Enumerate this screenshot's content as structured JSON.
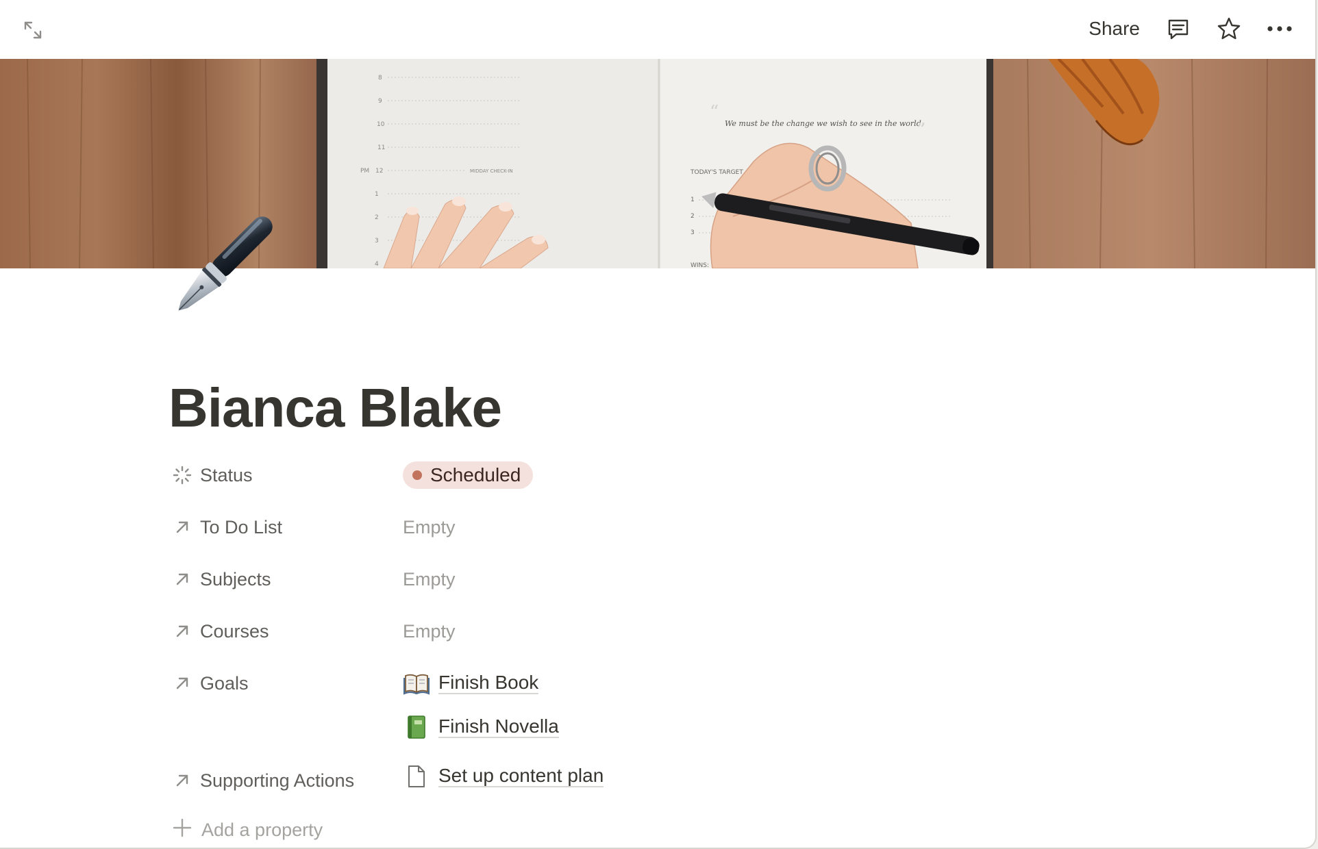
{
  "topbar": {
    "expand_icon": "expand-arrows-icon",
    "share_label": "Share",
    "comment_icon": "comment-icon",
    "favorite_icon": "star-icon",
    "more_icon": "more-dots-icon"
  },
  "cover": {
    "quote": "We must be the change we wish to see in the world.",
    "today_label": "TODAY'S TARGET",
    "wins_label": "WINS:",
    "pm_label": "PM",
    "midday_label": "MIDDAY CHECK-IN",
    "hours": [
      "8",
      "9",
      "10",
      "11",
      "12",
      "1",
      "2",
      "3",
      "4"
    ],
    "targets": [
      "1",
      "2",
      "3"
    ]
  },
  "page": {
    "icon": "fountain-pen-icon",
    "title": "Bianca Blake"
  },
  "properties": {
    "status": {
      "label": "Status",
      "icon": "status-spinner-icon",
      "value": "Scheduled",
      "color": "#c2735e",
      "bg": "#f4e0dc"
    },
    "todo": {
      "label": "To Do List",
      "icon": "relation-arrow-icon",
      "value": "Empty"
    },
    "subjects": {
      "label": "Subjects",
      "icon": "relation-arrow-icon",
      "value": "Empty"
    },
    "courses": {
      "label": "Courses",
      "icon": "relation-arrow-icon",
      "value": "Empty"
    },
    "goals": {
      "label": "Goals",
      "icon": "relation-arrow-icon",
      "items": [
        {
          "label": "Finish Book",
          "icon": "open-book-icon"
        },
        {
          "label": "Finish Novella",
          "icon": "green-book-icon"
        }
      ]
    },
    "supporting": {
      "label": "Supporting Actions",
      "icon": "relation-arrow-icon",
      "items": [
        {
          "label": "Set up content plan",
          "icon": "page-icon"
        }
      ]
    },
    "add_label": "Add a property"
  }
}
